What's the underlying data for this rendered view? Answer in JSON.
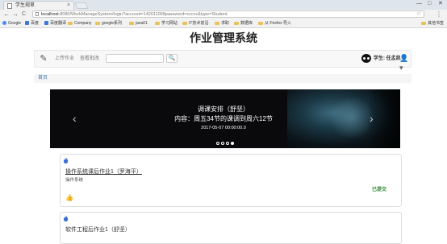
{
  "browser": {
    "tab_title": "学生规草",
    "tab_close": "×",
    "new_tab": "",
    "window_controls": [
      "—",
      "□",
      "✕"
    ],
    "back": "←",
    "forward": "→",
    "reload": "C",
    "url_host": "localhost",
    "url_rest": ":8080/WorkManageSystem/login?account=142011098password=ccccc&type=Student",
    "star": "☆",
    "menu": "⋮"
  },
  "bookmarks": [
    {
      "label": "Google",
      "icon": "google-icon"
    },
    {
      "label": "百度",
      "icon": "baidu-icon"
    },
    {
      "label": "百度翻译",
      "icon": "translate-icon"
    },
    {
      "label": "Company",
      "icon": "folder-icon"
    },
    {
      "label": "google系列",
      "icon": "folder-icon"
    },
    {
      "label": "java01",
      "icon": "folder-icon"
    },
    {
      "label": "学习网站",
      "icon": "folder-icon"
    },
    {
      "label": "IT技术前沿",
      "icon": "folder-icon"
    },
    {
      "label": "求职",
      "icon": "folder-icon"
    },
    {
      "label": "数据库",
      "icon": "folder-icon"
    },
    {
      "label": "从 Firefox 导入",
      "icon": "folder-icon"
    },
    {
      "label": "其他书签",
      "icon": "folder-icon"
    }
  ],
  "page": {
    "title": "作业管理系统"
  },
  "navbar": {
    "links": [
      "上传作业",
      "查看批改"
    ],
    "search_placeholder": "",
    "search_button": "🔍",
    "user_label": "学生: 任孟凯",
    "user_menu": "👤▾"
  },
  "breadcrumb": {
    "home": "首页"
  },
  "carousel": {
    "title": "调课安排（舒坚）",
    "content": "内容：周五34节的课调到周六12节",
    "date": "2017-05-07 00:00:00.0",
    "slides": 4,
    "active_index": 3,
    "prev": "‹",
    "next": "›"
  },
  "assignments": [
    {
      "title": "操作系统课后作业1（罗海平）",
      "subject": "操作系统",
      "status": "已提交"
    },
    {
      "title": "软件工程后作业1（舒坚）",
      "subject": "",
      "status": ""
    }
  ],
  "colors": {
    "link": "#3a75b0",
    "status_green": "#3a8a3a",
    "fire": "#3b6fd4"
  }
}
